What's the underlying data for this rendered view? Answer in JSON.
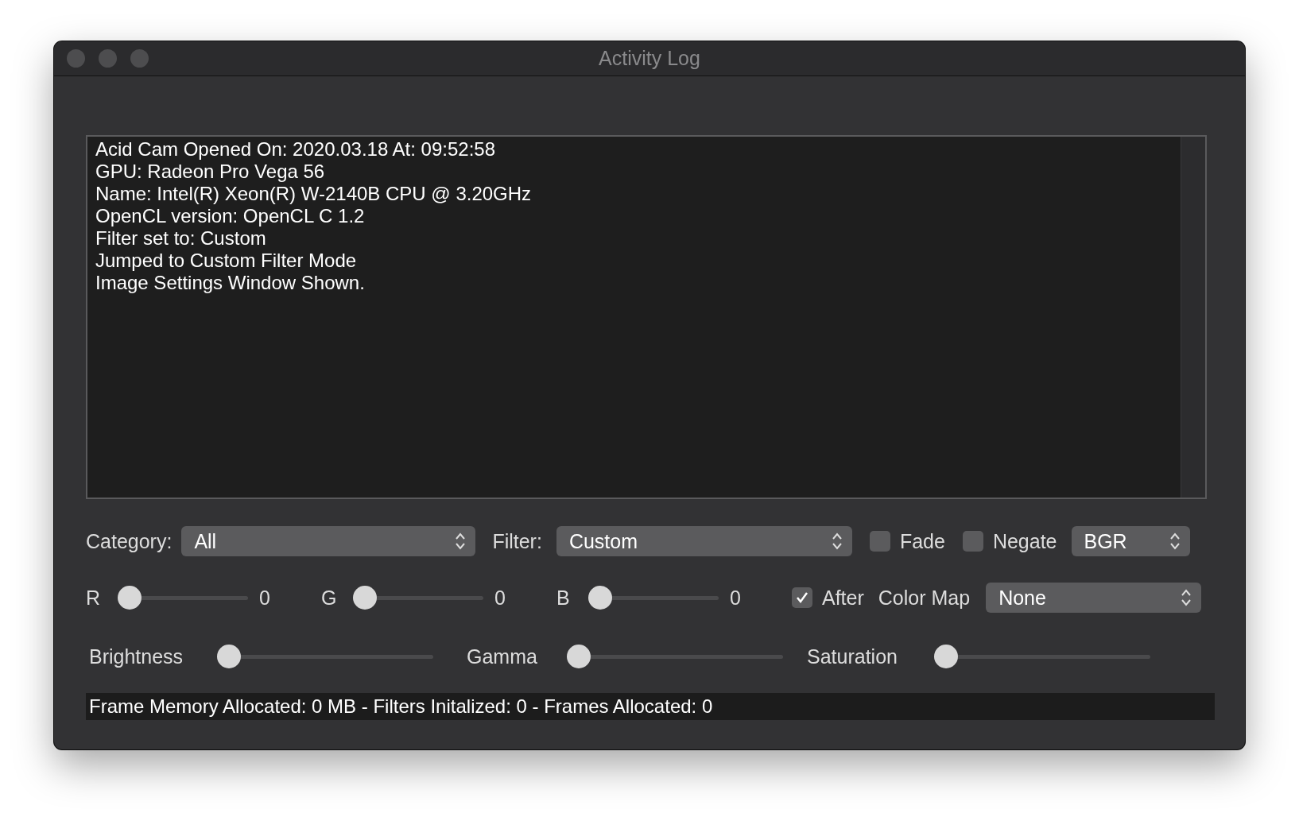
{
  "window": {
    "title": "Activity Log"
  },
  "log": {
    "lines": [
      "Acid Cam Opened On: 2020.03.18 At: 09:52:58",
      "GPU: Radeon Pro Vega 56",
      "Name: Intel(R) Xeon(R) W-2140B CPU @ 3.20GHz",
      "OpenCL version: OpenCL C 1.2",
      "Filter set to: Custom",
      "Jumped to Custom Filter Mode",
      "Image Settings Window Shown."
    ]
  },
  "category": {
    "label": "Category:",
    "value": "All"
  },
  "filter": {
    "label": "Filter:",
    "value": "Custom"
  },
  "toggles": [
    {
      "label": "Fade",
      "checked": false
    },
    {
      "label": "Negate",
      "checked": false
    }
  ],
  "color_order": {
    "value": "BGR"
  },
  "rgb_sliders": [
    {
      "label": "R",
      "level": 0,
      "reading": "0"
    },
    {
      "label": "G",
      "level": 0,
      "reading": "0"
    },
    {
      "label": "B",
      "level": 0,
      "reading": "0"
    }
  ],
  "after": {
    "label": "After",
    "checked": true
  },
  "color_map": {
    "label": "Color Map",
    "value": "None"
  },
  "adjust_sliders": [
    {
      "label": "Brightness",
      "level": 0
    },
    {
      "label": "Gamma",
      "level": 0
    },
    {
      "label": "Saturation",
      "level": 0
    }
  ],
  "status_bar": {
    "text": "Frame Memory Allocated: 0 MB - Filters Initalized: 0 - Frames Allocated: 0"
  }
}
